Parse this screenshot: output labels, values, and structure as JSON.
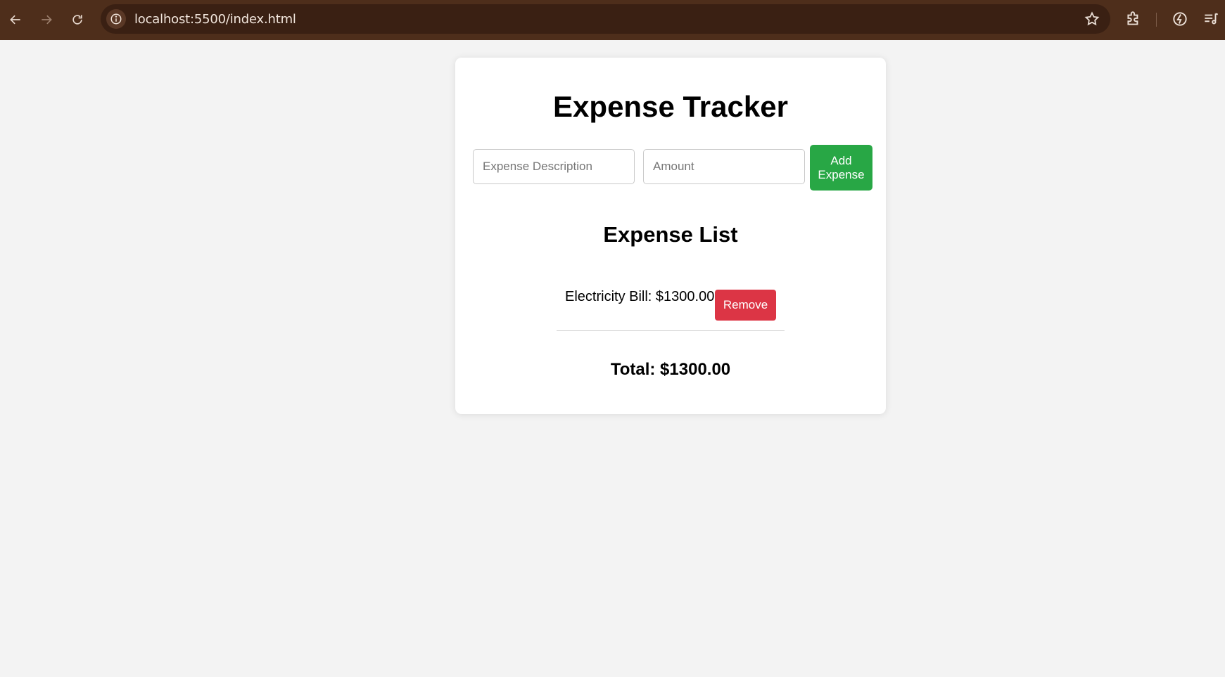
{
  "browser": {
    "url": "localhost:5500/index.html",
    "icons": {
      "back": "arrow-left-icon",
      "forward": "arrow-right-icon",
      "reload": "reload-icon",
      "site_info": "info-icon",
      "bookmark": "star-icon",
      "extensions": "puzzle-icon",
      "performance": "performance-icon",
      "media": "media-playlist-icon"
    },
    "colors": {
      "toolbar": "#4e2e1b",
      "omnibox": "#3a2013"
    }
  },
  "app": {
    "title": "Expense Tracker",
    "form": {
      "description_placeholder": "Expense Description",
      "amount_placeholder": "Amount",
      "description_value": "",
      "amount_value": "",
      "add_button_label": "Add Expense"
    },
    "list_title": "Expense List",
    "expenses": [
      {
        "text": "Electricity Bill: $1300.00",
        "remove_label": "Remove"
      }
    ],
    "total": "Total: $1300.00",
    "colors": {
      "add_button": "#28a745",
      "remove_button": "#dc3545",
      "background": "#f3f3f3",
      "card": "#ffffff"
    }
  }
}
